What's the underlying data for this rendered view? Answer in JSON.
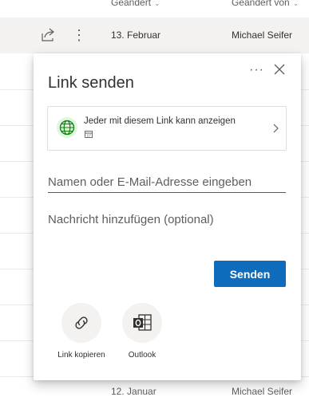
{
  "list": {
    "header": {
      "modified": "Geändert",
      "modified_by": "Geändert von"
    },
    "rows": [
      {
        "date": "13. Februar",
        "author": "Michael Seifer"
      },
      {
        "date": "12. Januar",
        "author": "Michael Seifer"
      }
    ]
  },
  "dialog": {
    "title": "Link senden",
    "more_label": "···",
    "permission_text": "Jeder mit diesem Link kann anzeigen",
    "name_placeholder": "Namen oder E-Mail-Adresse eingeben",
    "message_placeholder": "Nachricht hinzufügen (optional)",
    "send_label": "Senden",
    "options": [
      {
        "label": "Link kopieren",
        "icon": "link-icon"
      },
      {
        "label": "Outlook",
        "icon": "outlook-icon"
      }
    ]
  },
  "colors": {
    "accent": "#0f6cbd",
    "globe": "#107c10",
    "row_selected": "#f3f2f1"
  }
}
